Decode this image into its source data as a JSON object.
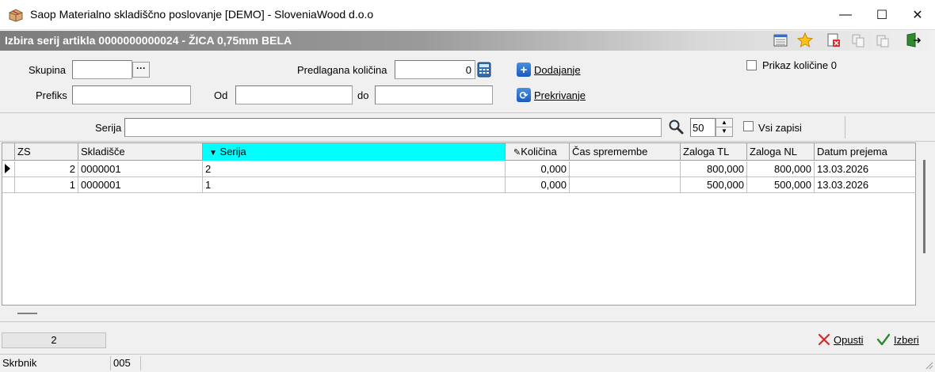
{
  "window": {
    "title": "Saop Materialno skladiščno poslovanje [DEMO] - SloveniaWood d.o.o",
    "minimize": "—",
    "maximize": "☐",
    "close": "✕"
  },
  "header": {
    "title": "Izbira serij artikla 0000000000024 - ŽICA 0,75mm BELA",
    "toolbar_icons": [
      "list-icon",
      "star-icon",
      "delete-icon",
      "copy-icon",
      "paste-icon",
      "exit-icon"
    ]
  },
  "form": {
    "skupina_label": "Skupina",
    "skupina_value": "",
    "skupina_button": "···",
    "prefiks_label": "Prefiks",
    "prefiks_value": "",
    "predlagana_label": "Predlagana količina",
    "predlagana_value": "0",
    "od_label": "Od",
    "od_value": "",
    "do_label": "do",
    "do_value": "",
    "dodajanje_label": "Dodajanje",
    "prekrivanje_label": "Prekrivanje",
    "prikaz_label": "Prikaz količine 0",
    "prikaz_checked": false
  },
  "search": {
    "serija_label": "Serija",
    "serija_value": "",
    "count_value": "50",
    "vsi_label": "Vsi zapisi",
    "vsi_checked": false
  },
  "grid": {
    "columns": [
      "ZS",
      "Skladišče",
      "Serija",
      "Količina",
      "Čas spremembe",
      "Zaloga TL",
      "Zaloga NL",
      "Datum prejema"
    ],
    "rows": [
      {
        "zs": "2",
        "skladisce": "0000001",
        "serija": "2",
        "kolicina": "0,000",
        "cas": "",
        "zaloga_tl": "800,000",
        "zaloga_nl": "800,000",
        "datum": "13.03.2026"
      },
      {
        "zs": "1",
        "skladisce": "0000001",
        "serija": "1",
        "kolicina": "0,000",
        "cas": "",
        "zaloga_tl": "500,000",
        "zaloga_nl": "500,000",
        "datum": "13.03.2026"
      }
    ]
  },
  "footer": {
    "record_count": "2",
    "opusti_label": "Opusti",
    "izberi_label": "Izberi"
  },
  "statusbar": {
    "user": "Skrbnik",
    "code": "005"
  },
  "colors": {
    "sorted_column": "#00ffff",
    "header_gradient_start": "#7c7c7c",
    "accent_blue": "#1a5cbf"
  }
}
